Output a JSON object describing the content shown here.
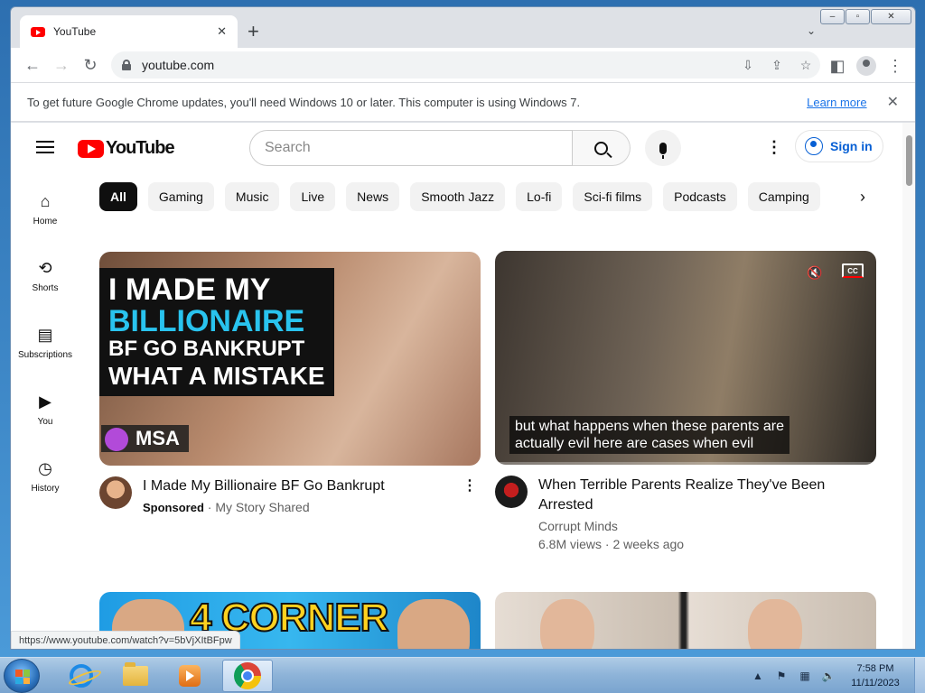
{
  "browser": {
    "tab_title": "YouTube",
    "url": "youtube.com",
    "new_tab_icon": "plus-icon",
    "tab_search_icon": "chevron-down-icon"
  },
  "infobar": {
    "message": "To get future Google Chrome updates, you'll need Windows 10 or later. This computer is using Windows 7.",
    "link": "Learn more"
  },
  "youtube": {
    "logo_text": "YouTube",
    "search_placeholder": "Search",
    "sign_in": "Sign in",
    "sidenav": [
      {
        "label": "Home",
        "icon": "home-icon"
      },
      {
        "label": "Shorts",
        "icon": "shorts-icon"
      },
      {
        "label": "Subscriptions",
        "icon": "subscriptions-icon"
      },
      {
        "label": "You",
        "icon": "you-icon"
      },
      {
        "label": "History",
        "icon": "history-icon"
      }
    ],
    "chips": [
      "All",
      "Gaming",
      "Music",
      "Live",
      "News",
      "Smooth Jazz",
      "Lo-fi",
      "Sci-fi films",
      "Podcasts",
      "Camping"
    ],
    "videos": [
      {
        "thumb_lines": [
          "I MADE MY",
          "BILLIONAIRE",
          "BF GO BANKRUPT",
          "WHAT A MISTAKE"
        ],
        "thumb_brand": "MSA",
        "title": "I Made My Billionaire BF Go Bankrupt",
        "sponsored": "Sponsored",
        "channel": "My Story Shared"
      },
      {
        "caption_line1": "but what happens when these parents are",
        "caption_line2": "actually evil here are cases when evil",
        "cc_label": "CC",
        "progress": 0.0,
        "title_line1": "When Terrible Parents Realize They've Been",
        "title_line2": "Arrested",
        "channel": "Corrupt Minds",
        "views": "6.8M views",
        "age": "2 weeks ago"
      },
      {
        "thumb_text": "4 CORNER"
      },
      {}
    ]
  },
  "status_url": "https://www.youtube.com/watch?v=5bVjXItBFpw",
  "taskbar": {
    "time": "7:58 PM",
    "date": "11/11/2023"
  }
}
